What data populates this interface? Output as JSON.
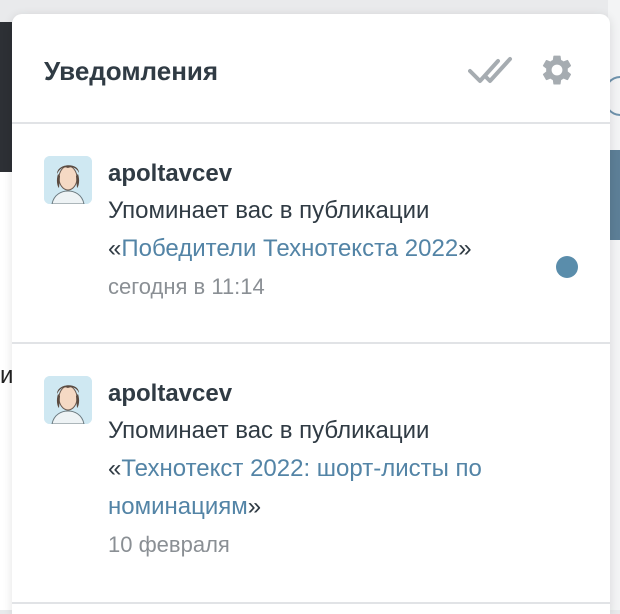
{
  "header": {
    "title": "Уведомления",
    "mark_read_icon": "double-check-icon",
    "settings_icon": "gear-icon"
  },
  "colors": {
    "link": "#5384a6",
    "unread_dot": "#5a8dab",
    "text": "#303b44",
    "muted": "#8a8f94"
  },
  "background": {
    "partial_text": "и"
  },
  "notifications": [
    {
      "user": "apoltavcev",
      "text": "Упоминает вас в публикации",
      "open_quote": "«",
      "link": "Победители Технотекста 2022",
      "close_quote": "»",
      "time": "сегодня в 11:14",
      "unread": true
    },
    {
      "user": "apoltavcev",
      "text": "Упоминает вас в публикации",
      "open_quote": "«",
      "link": "Технотекст 2022: шорт-листы по номинациям",
      "close_quote": "»",
      "time": "10 февраля",
      "unread": false
    }
  ]
}
